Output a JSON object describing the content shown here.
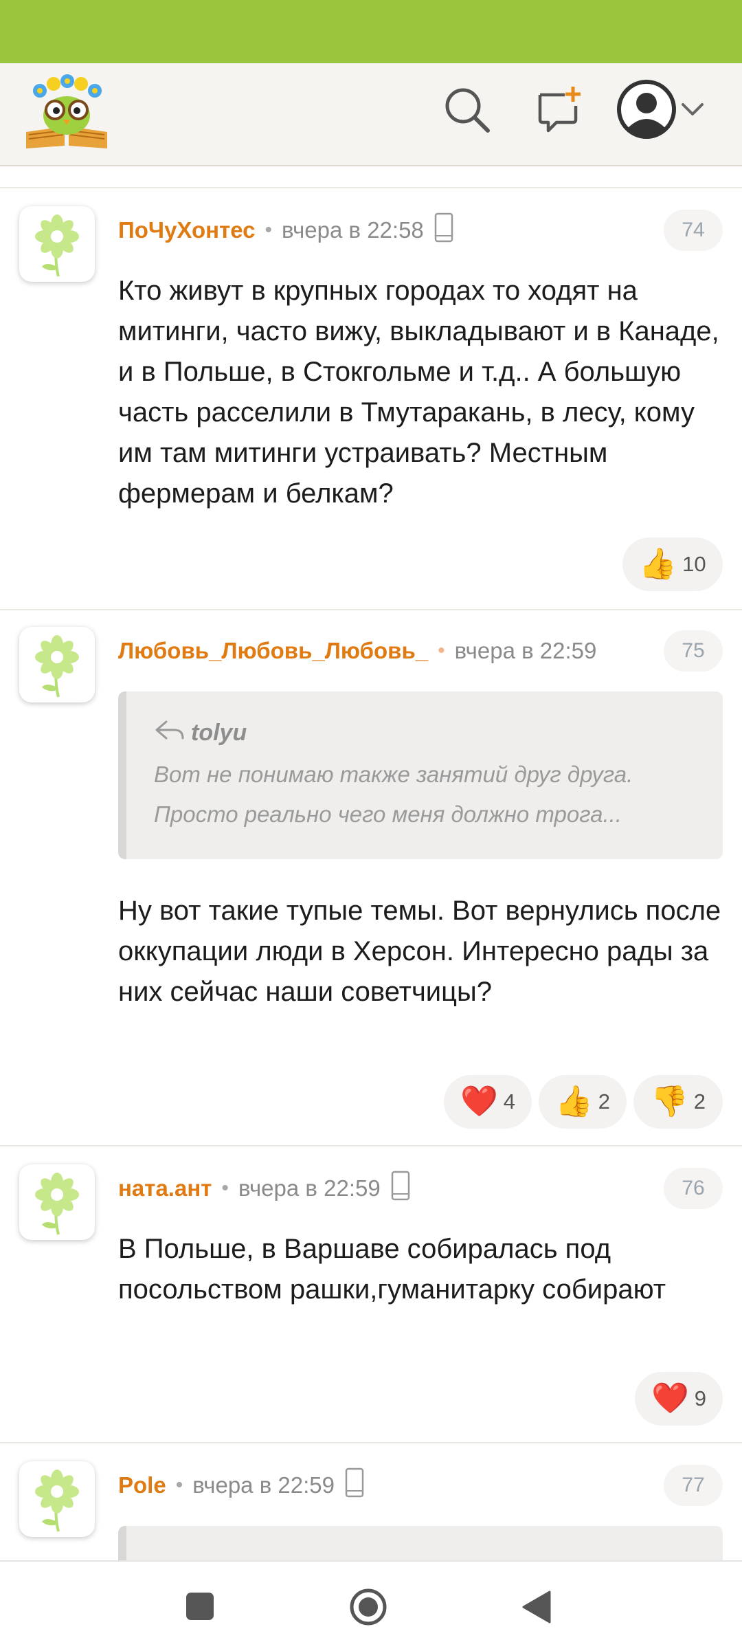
{
  "header": {
    "logo": "owl-on-book-logo",
    "icons": [
      "search-icon",
      "new-topic-icon",
      "profile-icon",
      "chevron-down-icon"
    ]
  },
  "colors": {
    "status_bar": "#9bc53d",
    "author": "#e07a12",
    "header_bg": "#f6f4f0"
  },
  "comments": [
    {
      "author": "ПоЧуХонтес",
      "time": "вчера в 22:58",
      "number": "74",
      "text": "Кто живут в крупных городах то ходят на митинги, часто вижу, выкладывают и в Канаде, и в Польше, в Стокгольме и т.д.. А большую часть расселили в Тмутаракань, в лесу, кому им там митинги устраивать? Местным фермерам и белкам?",
      "reactions": [
        {
          "icon": "👍",
          "count": "10"
        }
      ]
    },
    {
      "author": "Любовь_Любовь_Любовь_",
      "time": "вчера в 22:59",
      "number": "75",
      "quote": {
        "author": "tolyu",
        "line1": "Вот не понимаю также занятий друг друга.",
        "line2": "Просто  реально  чего  меня  должно  трога..."
      },
      "text": "Ну вот такие тупые темы. Вот вернулись после оккупации люди в Херсон. Интересно рады за них сейчас наши советчицы?",
      "reactions": [
        {
          "icon": "❤️",
          "count": "4"
        },
        {
          "icon": "👍",
          "count": "2"
        },
        {
          "icon": "👎",
          "count": "2"
        }
      ]
    },
    {
      "author": "ната.ант",
      "time": "вчера в 22:59",
      "number": "76",
      "text": "В Польше, в Варшаве собиралась под посольством рашки,гуманитарку собирают",
      "reactions": [
        {
          "icon": "❤️",
          "count": "9"
        }
      ]
    },
    {
      "author": "Pole",
      "time": "вчера в 22:59",
      "number": "77"
    }
  ],
  "nav": {
    "icons": [
      "recents-icon",
      "home-icon",
      "back-icon"
    ]
  }
}
